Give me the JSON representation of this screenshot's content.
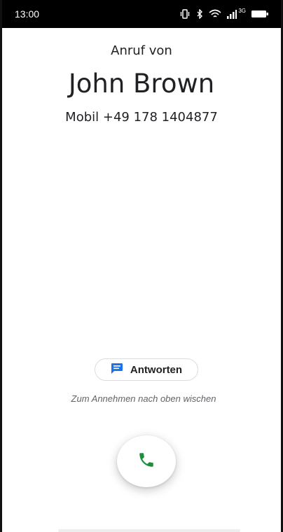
{
  "status_bar": {
    "time": "13:00",
    "network_label": "3G",
    "icons": [
      "vibrate-icon",
      "bluetooth-icon",
      "wifi-icon",
      "signal-icon",
      "battery-icon"
    ]
  },
  "call": {
    "incoming_label": "Anruf von",
    "caller_name": "John Brown",
    "caller_number": "Mobil +49 178 1404877"
  },
  "actions": {
    "reply_label": "Antworten",
    "swipe_hint": "Zum Annehmen nach oben wischen",
    "answer_icon": "phone-icon"
  },
  "colors": {
    "accent_blue": "#1a73e8",
    "answer_green": "#1e8e3e"
  }
}
